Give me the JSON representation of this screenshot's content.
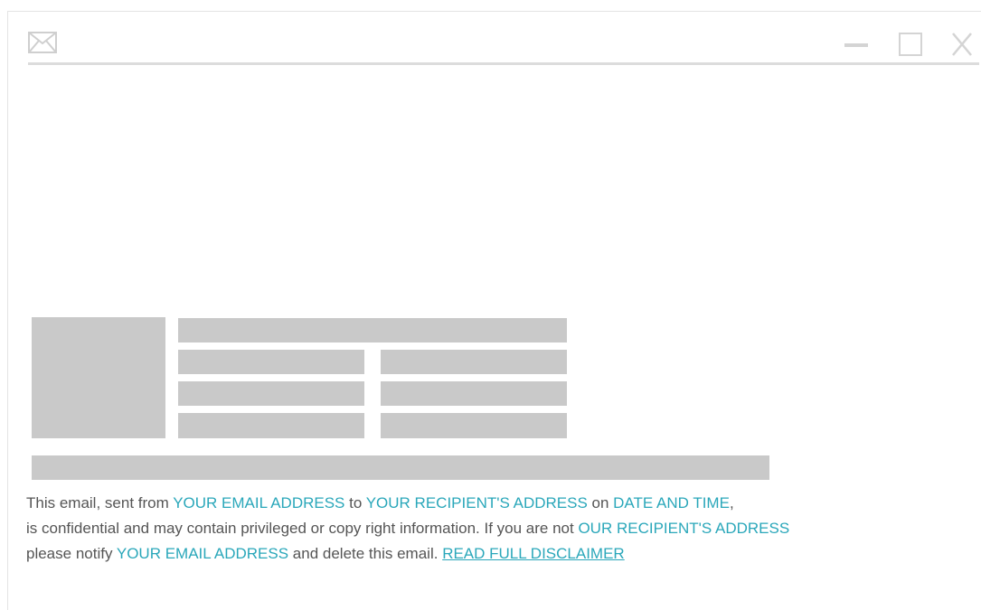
{
  "window": {
    "icons": {
      "mail": "mail-envelope-icon",
      "minimize": "minimize-icon",
      "maximize": "maximize-icon",
      "close": "close-icon"
    }
  },
  "colors": {
    "accent": "#2aa7ba",
    "text": "#555555",
    "placeholder": "#c9c9c9",
    "divider": "#dcdcdc"
  },
  "disclaimer": {
    "line1": {
      "t1": "This email, sent from ",
      "sender": "YOUR EMAIL ADDRESS",
      "t2": " to ",
      "recipient": "YOUR RECIPIENT'S ADDRESS",
      "t3": " on ",
      "datetime": "DATE AND TIME",
      "t4": ","
    },
    "line2": {
      "t1": "is confidential and may contain privileged or copy right information. If you are not ",
      "recipient": "OUR RECIPIENT'S ADDRESS"
    },
    "line3": {
      "t1": "please notify ",
      "sender": "YOUR EMAIL ADDRESS",
      "t2": " and delete this email. ",
      "link": "READ FULL DISCLAIMER"
    }
  }
}
